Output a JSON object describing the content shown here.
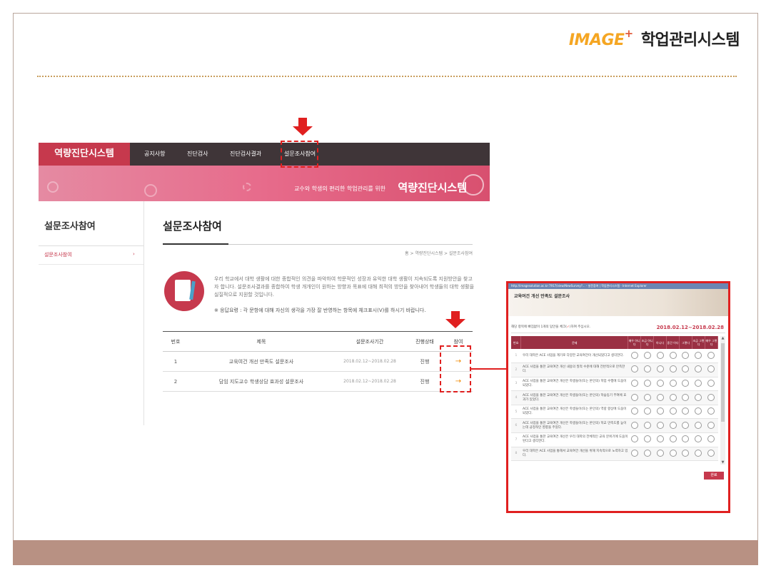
{
  "header": {
    "brand_image": "IMAGE",
    "brand_plus": "+",
    "brand_system": "학업관리시스템"
  },
  "app": {
    "logo": "역량진단시스템",
    "menu": [
      "공지사항",
      "진단검사",
      "진단검사결과",
      "설문조사참여"
    ],
    "banner_small": "교수와 학생의 편리한 학업관리를 위한",
    "banner_big": "역량진단시스템",
    "sidebar_title": "설문조사참여",
    "sidebar_item": "설문조사참여",
    "sidebar_arrow": "›",
    "page_title": "설문조사참여",
    "breadcrumb": "홈 > 역량진단시스템 > 설문조사참여",
    "intro_text": "우리 학교에서 대학 생활에 대한 종합적인 의견을 파악하여 학문적인 성장과 유익한 대학 생활이 지속되도록 지원방안을 찾고자 합니다. 설문조사결과를 종합하여 학생 개개인이 원하는 방향과 목표에 대해 최적의 방안을 찾아내어 학생들의 대학 생활을 실질적으로 지원할 것입니다.",
    "intro_note": "※ 응답요령 : 각 문항에 대해 자신의 생각을 가장 잘 반영하는 항목에 체크표시(V)를 하시기 바랍니다.",
    "table": {
      "headers": [
        "번호",
        "제목",
        "설문조사기간",
        "진행상태",
        "참여"
      ],
      "rows": [
        {
          "no": "1",
          "title": "교육여건 개선 만족도 설문조사",
          "period": "2018.02.12~2018.02.28",
          "status": "진행",
          "go": "→"
        },
        {
          "no": "2",
          "title": "담임 지도교수 학생상담 효과성 설문조사",
          "period": "2018.02.12~2018.02.28",
          "status": "진행",
          "go": "→"
        }
      ]
    }
  },
  "popup": {
    "titlebar": "http://imagesolution.ac.kr:7917/view/NewSurvey?... - 설문참여 | 학업관리시스템 - Internet Explorer",
    "title": "교육여건 개선 만족도 설문조사",
    "instruction_pre": "해당 항목에 빠짐없이 1개의 답안을 체크(",
    "instruction_check": "✓",
    "instruction_post": ")하여 주십시오.",
    "date": "2018.02.12~2018.02.28",
    "headers": [
      "번호",
      "문제",
      "매우 아니다",
      "조금 아니다",
      "아니다",
      "중간 이다",
      "그렇다",
      "조금 그렇다",
      "매우 그렇다"
    ],
    "questions": [
      {
        "no": "1",
        "text": "우리 대학은 ACE 사업을 계기로 다양한 교육여건이 개선되었다고 생각한다."
      },
      {
        "no": "2",
        "text": "ACE 사업을 통한 교육여건 개선 내용의 질적 수준에 대해 전반적으로 만족한다."
      },
      {
        "no": "3",
        "text": "ACE 사업을 통한 교육여건 개선은 학생들이(또는 본인의) 학업 수행에 도움이 되었다."
      },
      {
        "no": "4",
        "text": "ACE 사업을 통한 교육여건 개선은 학생들이(또는 본인의) 학습동기 부여에 효과가 있었다."
      },
      {
        "no": "5",
        "text": "ACE 사업을 통한 교육여건 개선은 학생들이(또는 본인의) 역량 향상에 도움이 되었다."
      },
      {
        "no": "6",
        "text": "ACE 사업을 통한 교육여건 개선은 학생들이(또는 본인의) 학교 만족도를 높이는데 긍정적인 영향을 주었다."
      },
      {
        "no": "7",
        "text": "ACE 사업을 통한 교육여건 개선은 우리 대학의 전체적인 교육 분위기에 도움이 된다고 생각한다."
      },
      {
        "no": "8",
        "text": "우리 대학은 ACE 사업을 통해서 교육여건 개선을 위해 지속적으로 노력하고 있다."
      }
    ],
    "submit": "완료",
    "scroll_up": "▲",
    "scroll_down": "▼"
  },
  "colors": {
    "highlight": "#e02020",
    "brand_red": "#c6394d",
    "nav_dark": "#3f3538",
    "footer": "#b89183"
  }
}
